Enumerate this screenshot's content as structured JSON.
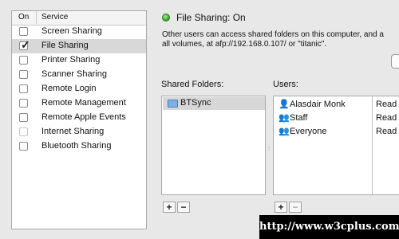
{
  "services": {
    "header": {
      "on": "On",
      "service": "Service"
    },
    "items": [
      {
        "label": "Screen Sharing",
        "checked": false,
        "selected": false,
        "disabled": false
      },
      {
        "label": "File Sharing",
        "checked": true,
        "selected": true,
        "disabled": false
      },
      {
        "label": "Printer Sharing",
        "checked": false,
        "selected": false,
        "disabled": false
      },
      {
        "label": "Scanner Sharing",
        "checked": false,
        "selected": false,
        "disabled": false
      },
      {
        "label": "Remote Login",
        "checked": false,
        "selected": false,
        "disabled": false
      },
      {
        "label": "Remote Management",
        "checked": false,
        "selected": false,
        "disabled": false
      },
      {
        "label": "Remote Apple Events",
        "checked": false,
        "selected": false,
        "disabled": false
      },
      {
        "label": "Internet Sharing",
        "checked": false,
        "selected": false,
        "disabled": true
      },
      {
        "label": "Bluetooth Sharing",
        "checked": false,
        "selected": false,
        "disabled": false
      }
    ]
  },
  "status": {
    "title": "File Sharing: On",
    "color": "#2fa120",
    "description_line1": "Other users can access shared folders on this computer, and a",
    "description_line2": "all volumes, at afp://192.168.0.107/ or \"titanic\"."
  },
  "shared_folders": {
    "label": "Shared Folders:",
    "items": [
      {
        "name": "BTSync"
      }
    ],
    "add": "+",
    "remove": "−"
  },
  "users": {
    "label": "Users:",
    "items": [
      {
        "name": "Alasdair Monk",
        "icon": "single-user-icon",
        "permission": "Read"
      },
      {
        "name": "Staff",
        "icon": "group-icon",
        "permission": "Read"
      },
      {
        "name": "Everyone",
        "icon": "group-icon",
        "permission": "Read"
      }
    ],
    "add": "+",
    "remove": "−"
  },
  "watermark": "http://www.w3cplus.com"
}
